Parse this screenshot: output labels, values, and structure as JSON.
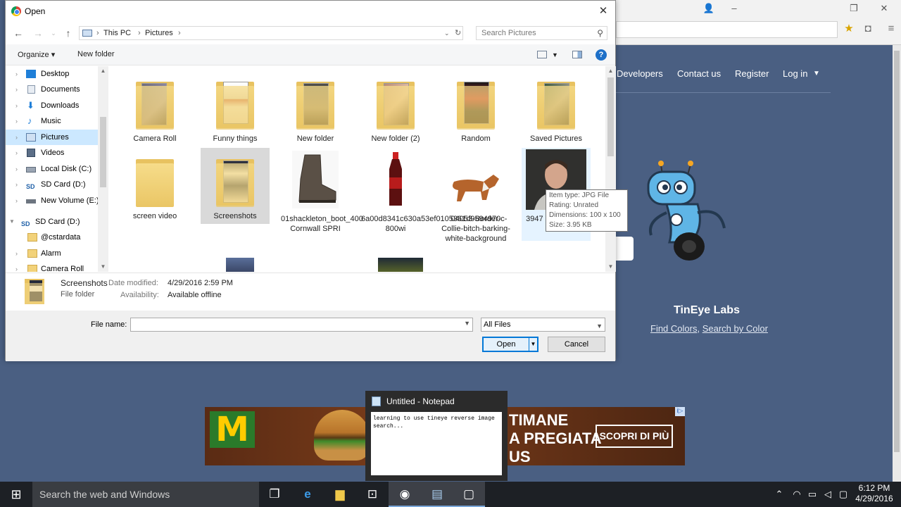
{
  "browser": {
    "nav_links": [
      "Developers",
      "Contact us",
      "Register",
      "Log in"
    ],
    "labs_title": "TinEye Labs",
    "labs_link_1": "Find Colors",
    "labs_link_sep": ",",
    "labs_link_2": "Search by Color"
  },
  "ad": {
    "logo": "M",
    "line1": "TIMANE",
    "line2": "A PREGIATA",
    "line3": "US",
    "button": "SCOPRI DI PIÙ",
    "info": "i▷"
  },
  "notepad_preview": {
    "title": "Untitled - Notepad",
    "text": "learning to use tineye reverse image search..."
  },
  "dialog": {
    "title": "Open",
    "path": [
      "This PC",
      "Pictures"
    ],
    "search_placeholder": "Search Pictures",
    "toolbar": {
      "organize": "Organize ▾",
      "new_folder": "New folder"
    },
    "nav_items": [
      {
        "label": "Desktop",
        "icon": "desktop-icon",
        "selected": false
      },
      {
        "label": "Documents",
        "icon": "documents-icon",
        "selected": false
      },
      {
        "label": "Downloads",
        "icon": "downloads-icon",
        "selected": false
      },
      {
        "label": "Music",
        "icon": "music-icon",
        "selected": false
      },
      {
        "label": "Pictures",
        "icon": "pictures-icon",
        "selected": true
      },
      {
        "label": "Videos",
        "icon": "videos-icon",
        "selected": false
      },
      {
        "label": "Local Disk (C:)",
        "icon": "disk-icon",
        "selected": false
      },
      {
        "label": "SD Card (D:)",
        "icon": "sd-card-icon",
        "selected": false
      },
      {
        "label": "New Volume (E:)",
        "icon": "drive-icon",
        "selected": false
      },
      {
        "label": "SD Card (D:)",
        "icon": "sd-card-icon",
        "selected": false
      },
      {
        "label": "@cstardata",
        "icon": "folder-icon",
        "selected": false
      },
      {
        "label": "Alarm",
        "icon": "folder-icon",
        "selected": false
      },
      {
        "label": "Camera Roll",
        "icon": "folder-icon",
        "selected": false
      }
    ],
    "files": [
      {
        "label": "Camera Roll",
        "kind": "folder"
      },
      {
        "label": "Funny things",
        "kind": "folder"
      },
      {
        "label": "New folder",
        "kind": "folder"
      },
      {
        "label": "New folder (2)",
        "kind": "folder"
      },
      {
        "label": "Random",
        "kind": "folder"
      },
      {
        "label": "Saved Pictures",
        "kind": "folder"
      },
      {
        "label": "screen video",
        "kind": "folder"
      },
      {
        "label": "Screenshots",
        "kind": "folder",
        "selected": true
      },
      {
        "label": "01shackleton_boot_400 Cornwall SPRI",
        "kind": "image"
      },
      {
        "label": "6a00d8341c630a53ef0105361d9594970c-800wi",
        "kind": "image"
      },
      {
        "label": "04053-Border-Collie-bitch-barking-white-background",
        "kind": "image"
      },
      {
        "label": "3947 1673 909_n",
        "kind": "image"
      }
    ],
    "tooltip": [
      "Item type: JPG File",
      "Rating: Unrated",
      "Dimensions: 100 x 100",
      "Size: 3.95 KB"
    ],
    "details": {
      "name": "Screenshots",
      "type": "File folder",
      "modified_label": "Date modified:",
      "modified_value": "4/29/2016 2:59 PM",
      "availability_label": "Availability:",
      "availability_value": "Available offline"
    },
    "file_name_label": "File name:",
    "file_name_value": "",
    "filter": "All Files",
    "open_label": "Open",
    "cancel_label": "Cancel"
  },
  "taskbar": {
    "search_placeholder": "Search the web and Windows",
    "time": "6:12 PM",
    "date": "4/29/2016"
  }
}
